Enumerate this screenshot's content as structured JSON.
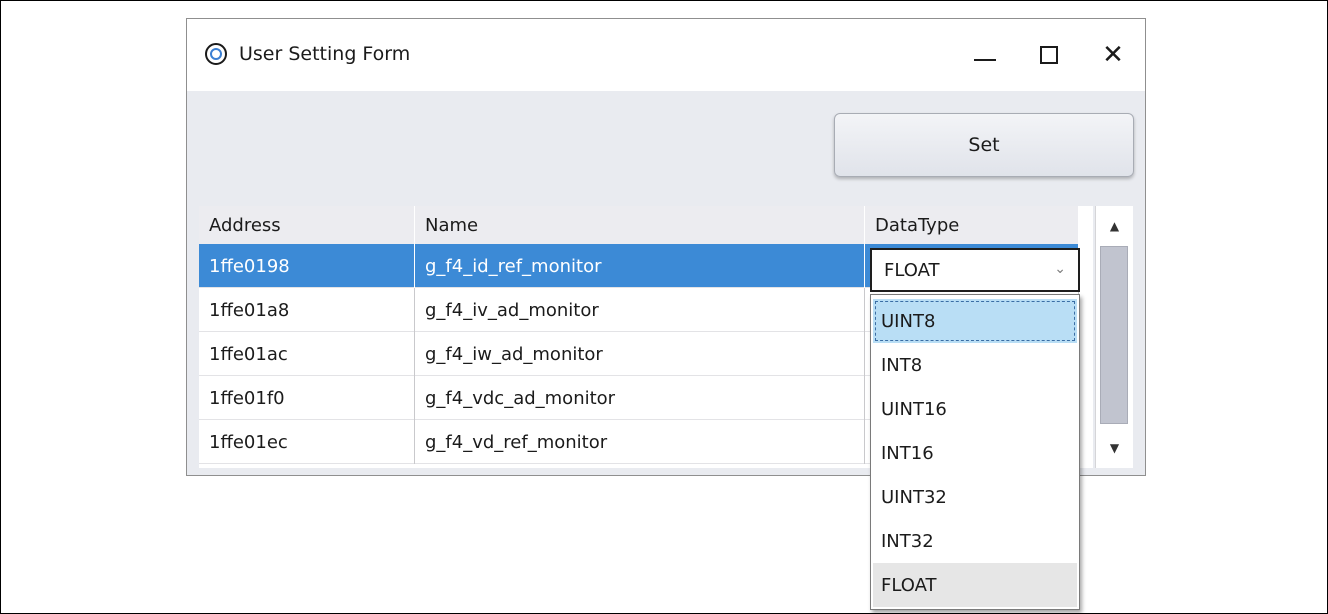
{
  "window": {
    "title": "User Setting Form",
    "minimize": "—",
    "maximize": "☐",
    "close": "✕"
  },
  "toolbar": {
    "set_label": "Set"
  },
  "grid": {
    "columns": [
      "Address",
      "Name",
      "DataType"
    ],
    "rows": [
      {
        "address": "1ffe0198",
        "name": "g_f4_id_ref_monitor",
        "datatype": "FLOAT"
      },
      {
        "address": "1ffe01a8",
        "name": "g_f4_iv_ad_monitor",
        "datatype": ""
      },
      {
        "address": "1ffe01ac",
        "name": "g_f4_iw_ad_monitor",
        "datatype": ""
      },
      {
        "address": "1ffe01f0",
        "name": "g_f4_vdc_ad_monitor",
        "datatype": ""
      },
      {
        "address": "1ffe01ec",
        "name": "g_f4_vd_ref_monitor",
        "datatype": ""
      }
    ],
    "selected_row": 0
  },
  "datatype_combo": {
    "value": "FLOAT",
    "options": [
      "UINT8",
      "INT8",
      "UINT16",
      "INT16",
      "UINT32",
      "INT32",
      "FLOAT"
    ],
    "focused_option": "UINT8"
  },
  "colors": {
    "selection": "#3c8ad6",
    "focused_option": "#b9def5",
    "window_bg": "#e9ebf0"
  }
}
